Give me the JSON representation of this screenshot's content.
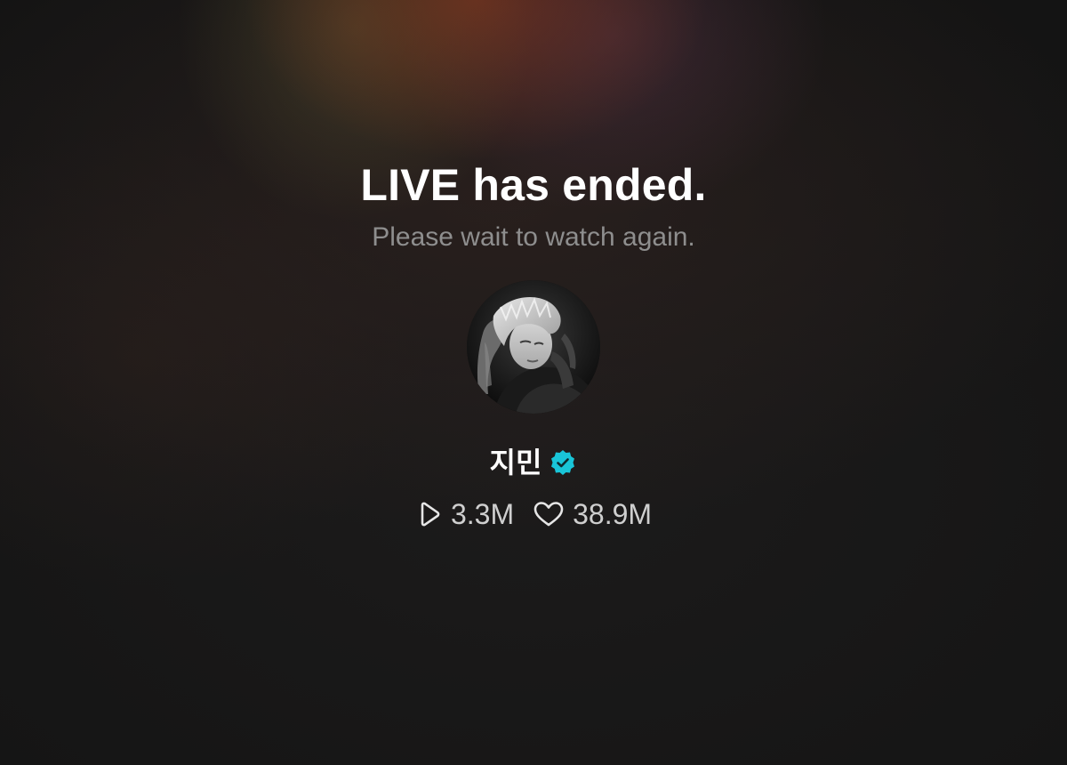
{
  "live_status": {
    "title": "LIVE has ended.",
    "subtitle": "Please wait to watch again."
  },
  "artist": {
    "name": "지민",
    "verified": true,
    "avatar": "profile-photo"
  },
  "stats": {
    "plays": {
      "icon": "play-icon",
      "value": "3.3M"
    },
    "likes": {
      "icon": "heart-icon",
      "value": "38.9M"
    }
  },
  "colors": {
    "background": "#161616",
    "title": "#ffffff",
    "subtitle": "#8e8e8e",
    "stats_text": "#cfcfcf",
    "verified_badge": "#19c5d8"
  }
}
